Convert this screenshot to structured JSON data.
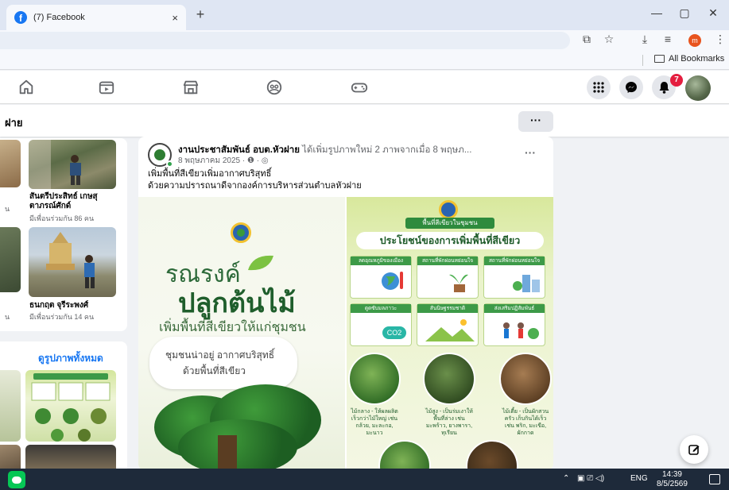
{
  "browser": {
    "tab_title": "(7) Facebook",
    "tab_close": "×",
    "new_tab": "+",
    "minimize": "—",
    "maximize": "▢",
    "close": "✕",
    "profile_initial": "m",
    "bookmarks_label": "All Bookmarks"
  },
  "fb_nav": {
    "notification_count": "7"
  },
  "subheader": {
    "title": "ฝาย",
    "more_label": "···"
  },
  "friends": [
    {
      "name_line1": "สันตรีประสิทธ์ เกษสุ",
      "name_line2": "ตาภรณ์ศักด์",
      "mutual": "มีเพื่อนร่วมกัน 86 คน",
      "cut_left": "น"
    },
    {
      "name_line1": "ธนกฤต จุรีระพงศ์",
      "name_line2": "",
      "mutual": "มีเพื่อนร่วมกัน 14 คน",
      "cut_left": "น"
    }
  ],
  "photos": {
    "link": "ดูรูปภาพทั้งหมด"
  },
  "post": {
    "author": "งานประชาสัมพันธ์ อบต.หัวฝาย",
    "action": " ได้เพิ่มรูปภาพใหม่ 2 ภาพจากเมื่อ 8 พฤษภ...",
    "date": "8 พฤษภาคม 2025 · ❶ · ◎",
    "dots": "···",
    "text_line1": "เพิ่มพื้นที่สีเขียวเพิ่มอากาศบริสุทธิ์",
    "text_line2": "ด้วยความปรารถนาดีจากองค์การบริหารส่วนตำบลหัวฝาย",
    "image_left": {
      "line1": "รณรงค์",
      "line2": "ปลูกต้นไม้",
      "line3": "เพิ่มพื้นที่สีเขียวให้แก่ชุมชน",
      "bubble1": "ชุมชนน่าอยู่  อากาศบริสุทธิ์",
      "bubble2": "ด้วยพื้นที่สีเขียว"
    },
    "image_right": {
      "banner": "พื้นที่สีเขียวในชุมชน",
      "title": "ประโยชน์ของการเพิ่มพื้นที่สีเขียว",
      "cells": [
        "ลดอุณหภูมิของเมือง",
        "สถานที่พักผ่อนหย่อนใจ",
        "สถานที่พักผ่อนหย่อนใจ",
        "ดูดซับมลภาวะ",
        "สันนิษฐรรมชาติ",
        "ส่งเสริมปฏิสัมพันธ์"
      ],
      "co2": "CO2",
      "captions": [
        "ไม้กลาง - ให้ผลผลิตเร็วกว่าไม้ใหญ่ เช่น กล้วย, มะละกอ, มะนาว",
        "ไม้สูง - เป็นร่มเงาให้พื้นที่ล่าง เช่น มะพร้าว, ยางพารา, ทุเรียน",
        "ไม้เตี้ย - เป็นผักสวนครัว เก็บกินได้เร็ว เช่น พริก, มะเขือ, ผักกาด"
      ]
    }
  },
  "taskbar": {
    "tray_up": "⌃",
    "tray_icons": "▣  ⎚  ◁)",
    "lang": "ENG",
    "time": "14:39",
    "date": "8/5/2569"
  }
}
